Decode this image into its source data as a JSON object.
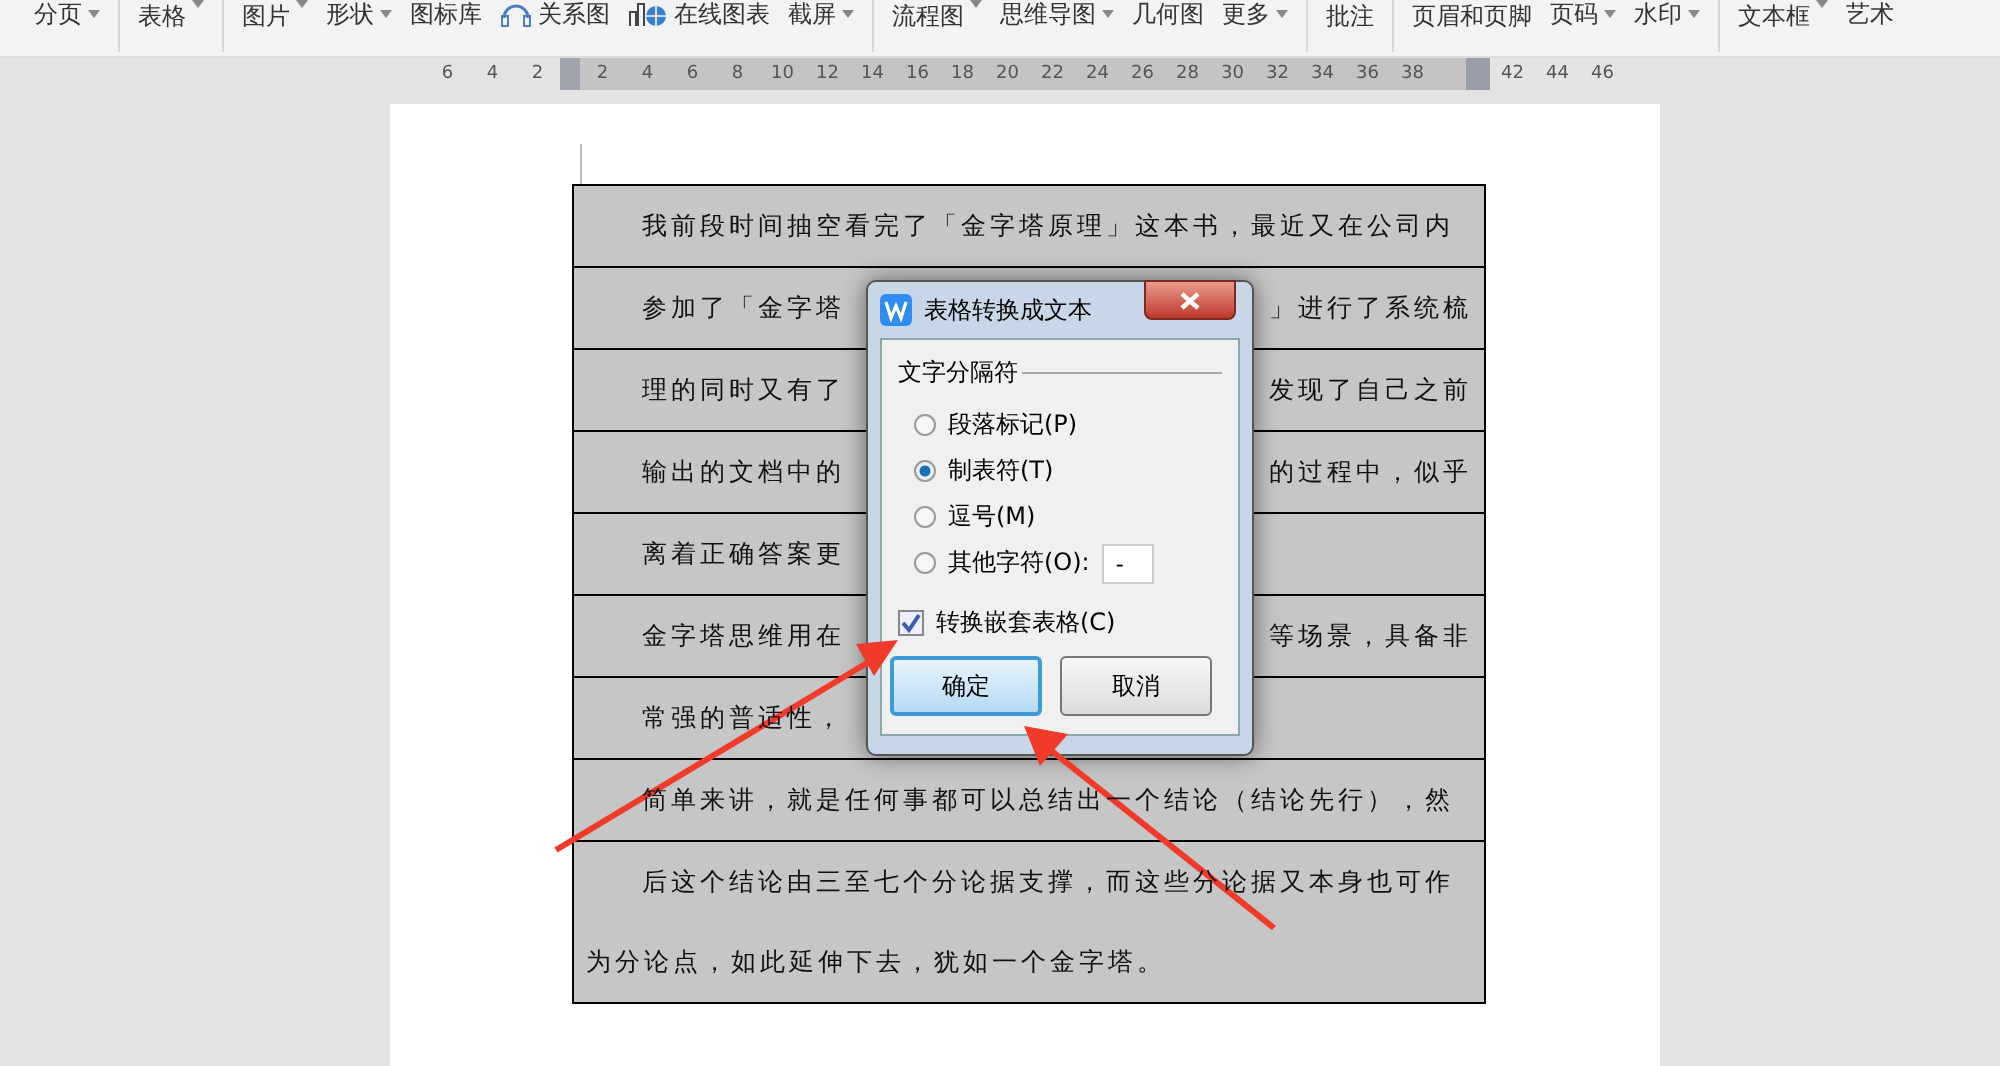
{
  "toolbar": [
    {
      "label": "分页",
      "dropdown": true,
      "sep_before": false
    },
    {
      "label": "表格",
      "dropdown": true,
      "sep_before": true
    },
    {
      "label": "图片",
      "dropdown": true,
      "sep_before": true
    },
    {
      "label": "形状",
      "dropdown": true,
      "sep_before": false
    },
    {
      "label": "图标库",
      "dropdown": false,
      "sep_before": false
    },
    {
      "label": "关系图",
      "dropdown": false,
      "sep_before": false,
      "kind": "icon"
    },
    {
      "label": "在线图表",
      "dropdown": false,
      "sep_before": false,
      "kind": "icon"
    },
    {
      "label": "截屏",
      "dropdown": true,
      "sep_before": false
    },
    {
      "label": "流程图",
      "dropdown": true,
      "sep_before": true
    },
    {
      "label": "思维导图",
      "dropdown": true,
      "sep_before": false
    },
    {
      "label": "几何图",
      "dropdown": false,
      "sep_before": false
    },
    {
      "label": "更多",
      "dropdown": true,
      "sep_before": false
    },
    {
      "label": "批注",
      "dropdown": false,
      "sep_before": true
    },
    {
      "label": "页眉和页脚",
      "dropdown": false,
      "sep_before": true
    },
    {
      "label": "页码",
      "dropdown": true,
      "sep_before": false
    },
    {
      "label": "水印",
      "dropdown": true,
      "sep_before": false
    },
    {
      "label": "文本框",
      "dropdown": true,
      "sep_before": true
    },
    {
      "label": "艺术",
      "dropdown": false,
      "sep_before": false
    }
  ],
  "ruler": {
    "left_ticks": [
      "6",
      "4",
      "2"
    ],
    "ticks": [
      "2",
      "4",
      "6",
      "8",
      "10",
      "12",
      "14",
      "16",
      "18",
      "20",
      "22",
      "24",
      "26",
      "28",
      "30",
      "32",
      "34",
      "36",
      "38"
    ],
    "right_ticks": [
      "42",
      "44",
      "46"
    ]
  },
  "table": {
    "rows": [
      {
        "left": "我前段时间抽空看完了「金字塔原理」这本书，最近又在公司内"
      },
      {
        "left": "参加了「金字塔",
        "right": "」进行了系统梳"
      },
      {
        "left": "理的同时又有了",
        "right": "发现了自己之前"
      },
      {
        "left": "输出的文档中的",
        "right": "的过程中，似乎"
      },
      {
        "left": "离着正确答案更"
      },
      {
        "left": "金字塔思维用在",
        "right": "等场景，具备非"
      },
      {
        "left": "常强的普适性，"
      },
      {
        "left": "简单来讲，就是任何事都可以总结出一个结论（结论先行），然"
      },
      {
        "left": "后这个结论由三至七个分论据支撑，而这些分论据又本身也可作为分论点，如此延伸下去，犹如一个金字塔。"
      }
    ]
  },
  "dialog": {
    "title": "表格转换成文本",
    "group": "文字分隔符",
    "options": [
      {
        "label": "段落标记(P)",
        "selected": false
      },
      {
        "label": "制表符(T)",
        "selected": true
      },
      {
        "label": "逗号(M)",
        "selected": false
      },
      {
        "label": "其他字符(O):",
        "selected": false,
        "value": "-"
      }
    ],
    "nested": {
      "label": "转换嵌套表格(C)",
      "checked": true
    },
    "buttons": [
      {
        "label": "确定",
        "default": true
      },
      {
        "label": "取消",
        "default": false
      }
    ]
  }
}
